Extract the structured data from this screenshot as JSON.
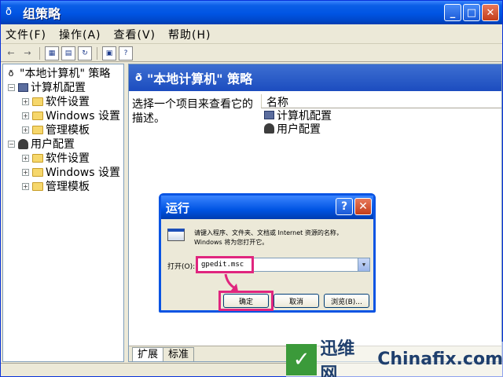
{
  "window": {
    "title": "组策略",
    "icon": "policy-icon",
    "buttons": {
      "minimize": "_",
      "maximize": "□",
      "close": "✕"
    }
  },
  "menu": [
    {
      "label": "文件(F)"
    },
    {
      "label": "操作(A)"
    },
    {
      "label": "查看(V)"
    },
    {
      "label": "帮助(H)"
    }
  ],
  "toolbar": {
    "back": "←",
    "forward": "→"
  },
  "tree": {
    "root": "\"本地计算机\" 策略",
    "computer_config": "计算机配置",
    "software_settings_1": "软件设置",
    "windows_settings_1": "Windows 设置",
    "admin_templates_1": "管理模板",
    "user_config": "用户配置",
    "software_settings_2": "软件设置",
    "windows_settings_2": "Windows 设置",
    "admin_templates_2": "管理模板"
  },
  "right_pane": {
    "header": "\"本地计算机\" 策略",
    "description": "选择一个项目来查看它的描述。",
    "column_name": "名称",
    "items": [
      {
        "label": "计算机配置"
      },
      {
        "label": "用户配置"
      }
    ],
    "tabs": [
      {
        "label": "扩展"
      },
      {
        "label": "标准"
      }
    ]
  },
  "run_dialog": {
    "title": "运行",
    "help_button": "?",
    "close_button": "✕",
    "prompt": "请键入程序、文件夹、文档或 Internet 资源的名称，Windows 将为您打开它。",
    "open_label": "打开(O):",
    "input_value": "gpedit.msc",
    "ok_label": "确定",
    "cancel_label": "取消",
    "browse_label": "浏览(B)...",
    "highlight_color": "#e0257e"
  },
  "watermark": {
    "logo": "✓",
    "name_cn": "迅维网",
    "name_en": "Chinafix.com"
  }
}
